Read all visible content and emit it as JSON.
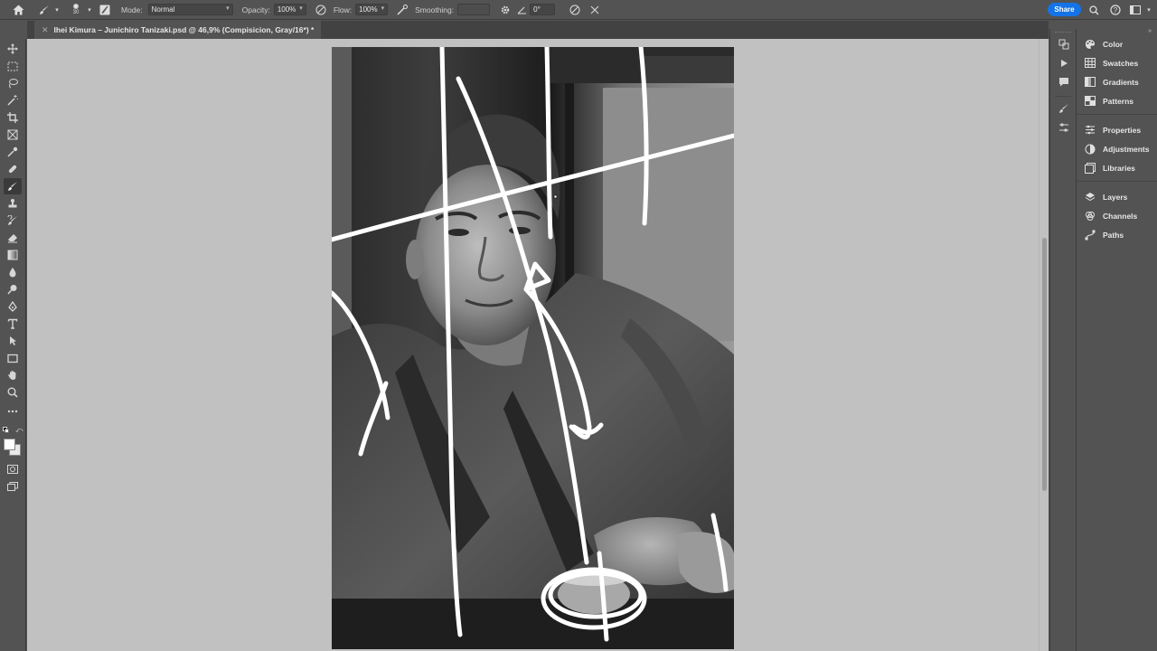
{
  "options_bar": {
    "brush_size": "30",
    "mode_label": "Mode:",
    "mode_value": "Normal",
    "opacity_label": "Opacity:",
    "opacity_value": "100%",
    "flow_label": "Flow:",
    "flow_value": "100%",
    "smoothing_label": "Smoothing:",
    "smoothing_value": "",
    "angle_value": "0°",
    "share_label": "Share"
  },
  "document": {
    "tab_title": "Ihei Kimura – Junichiro Tanizaki.psd @ 46,9% (Compisicion, Gray/16*) *"
  },
  "panels": {
    "group1": [
      {
        "label": "Color",
        "icon": "color-icon"
      },
      {
        "label": "Swatches",
        "icon": "swatches-icon"
      },
      {
        "label": "Gradients",
        "icon": "gradients-icon"
      },
      {
        "label": "Patterns",
        "icon": "patterns-icon"
      }
    ],
    "group2": [
      {
        "label": "Properties",
        "icon": "properties-icon"
      },
      {
        "label": "Adjustments",
        "icon": "adjustments-icon"
      },
      {
        "label": "Libraries",
        "icon": "libraries-icon"
      }
    ],
    "group3": [
      {
        "label": "Layers",
        "icon": "layers-icon"
      },
      {
        "label": "Channels",
        "icon": "channels-icon"
      },
      {
        "label": "Paths",
        "icon": "paths-icon"
      }
    ]
  },
  "colors": {
    "accent": "#1473e6",
    "chrome": "#535353",
    "canvas_bg": "#c1c1c1"
  }
}
